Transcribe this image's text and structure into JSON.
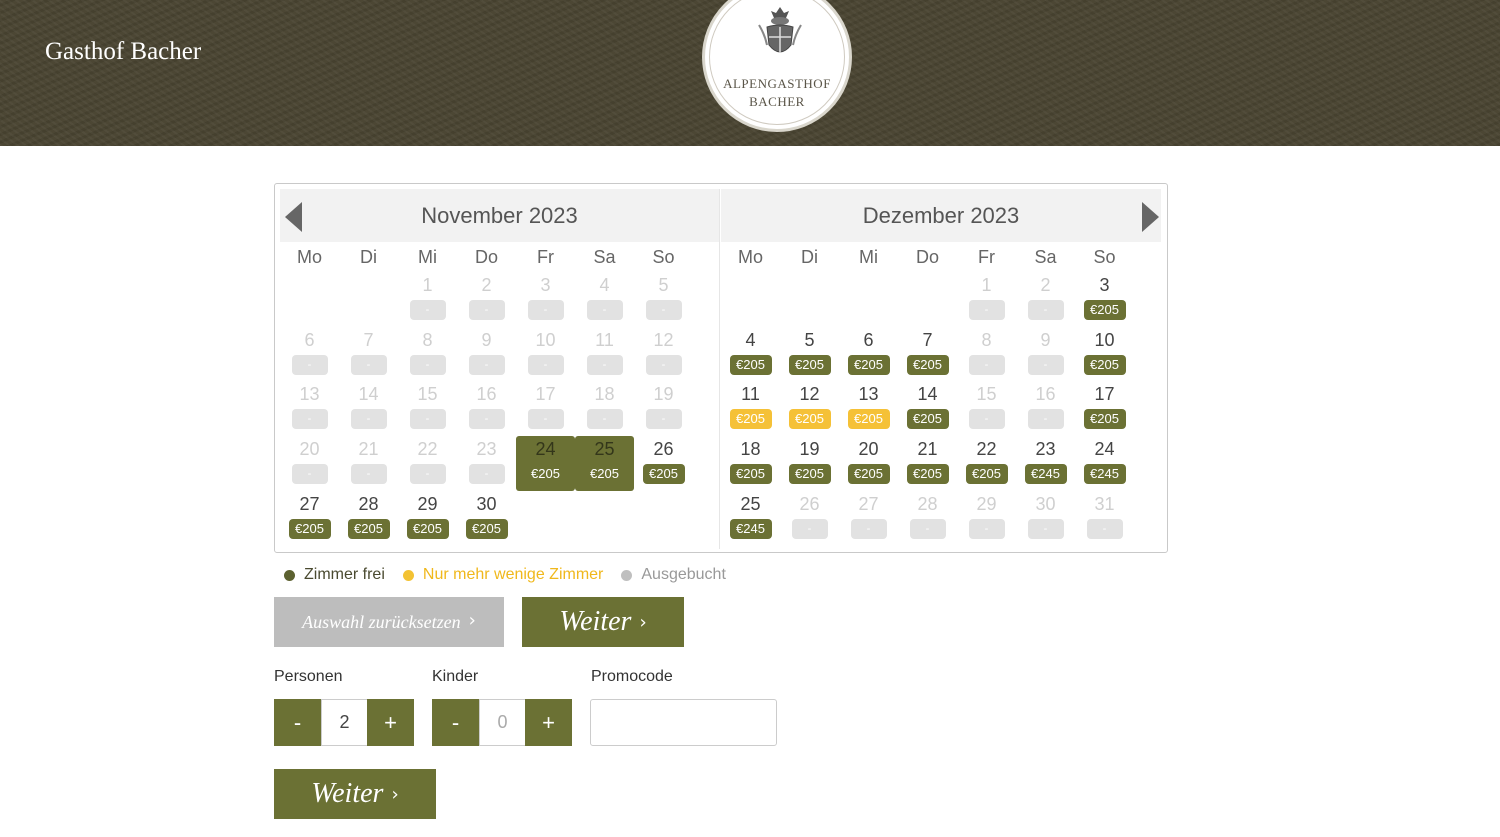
{
  "header": {
    "brand": "Gasthof Bacher",
    "logo_line1": "ALPENGASTHOF",
    "logo_line2": "BACHER"
  },
  "calendar": {
    "weekday_labels": [
      "Mo",
      "Di",
      "Mi",
      "Do",
      "Fr",
      "Sa",
      "So"
    ],
    "months": [
      {
        "title": "November 2023",
        "weeks": [
          [
            null,
            null,
            {
              "d": "1",
              "p": "-",
              "s": "na"
            },
            {
              "d": "2",
              "p": "-",
              "s": "na"
            },
            {
              "d": "3",
              "p": "-",
              "s": "na"
            },
            {
              "d": "4",
              "p": "-",
              "s": "na"
            },
            {
              "d": "5",
              "p": "-",
              "s": "na"
            }
          ],
          [
            {
              "d": "6",
              "p": "-",
              "s": "na"
            },
            {
              "d": "7",
              "p": "-",
              "s": "na"
            },
            {
              "d": "8",
              "p": "-",
              "s": "na"
            },
            {
              "d": "9",
              "p": "-",
              "s": "na"
            },
            {
              "d": "10",
              "p": "-",
              "s": "na"
            },
            {
              "d": "11",
              "p": "-",
              "s": "na"
            },
            {
              "d": "12",
              "p": "-",
              "s": "na"
            }
          ],
          [
            {
              "d": "13",
              "p": "-",
              "s": "na"
            },
            {
              "d": "14",
              "p": "-",
              "s": "na"
            },
            {
              "d": "15",
              "p": "-",
              "s": "na"
            },
            {
              "d": "16",
              "p": "-",
              "s": "na"
            },
            {
              "d": "17",
              "p": "-",
              "s": "na"
            },
            {
              "d": "18",
              "p": "-",
              "s": "na"
            },
            {
              "d": "19",
              "p": "-",
              "s": "na"
            }
          ],
          [
            {
              "d": "20",
              "p": "-",
              "s": "na"
            },
            {
              "d": "21",
              "p": "-",
              "s": "na"
            },
            {
              "d": "22",
              "p": "-",
              "s": "na"
            },
            {
              "d": "23",
              "p": "-",
              "s": "na"
            },
            {
              "d": "24",
              "p": "€205",
              "s": "sel"
            },
            {
              "d": "25",
              "p": "€205",
              "s": "sel"
            },
            {
              "d": "26",
              "p": "€205",
              "s": "free"
            }
          ],
          [
            {
              "d": "27",
              "p": "€205",
              "s": "free"
            },
            {
              "d": "28",
              "p": "€205",
              "s": "free"
            },
            {
              "d": "29",
              "p": "€205",
              "s": "free"
            },
            {
              "d": "30",
              "p": "€205",
              "s": "free"
            },
            null,
            null,
            null
          ]
        ]
      },
      {
        "title": "Dezember 2023",
        "weeks": [
          [
            null,
            null,
            null,
            null,
            {
              "d": "1",
              "p": "-",
              "s": "na"
            },
            {
              "d": "2",
              "p": "-",
              "s": "na"
            },
            {
              "d": "3",
              "p": "€205",
              "s": "free"
            }
          ],
          [
            {
              "d": "4",
              "p": "€205",
              "s": "free"
            },
            {
              "d": "5",
              "p": "€205",
              "s": "free"
            },
            {
              "d": "6",
              "p": "€205",
              "s": "free"
            },
            {
              "d": "7",
              "p": "€205",
              "s": "free"
            },
            {
              "d": "8",
              "p": "-",
              "s": "na"
            },
            {
              "d": "9",
              "p": "-",
              "s": "na"
            },
            {
              "d": "10",
              "p": "€205",
              "s": "free"
            }
          ],
          [
            {
              "d": "11",
              "p": "€205",
              "s": "few"
            },
            {
              "d": "12",
              "p": "€205",
              "s": "few"
            },
            {
              "d": "13",
              "p": "€205",
              "s": "few"
            },
            {
              "d": "14",
              "p": "€205",
              "s": "free"
            },
            {
              "d": "15",
              "p": "-",
              "s": "na"
            },
            {
              "d": "16",
              "p": "-",
              "s": "na"
            },
            {
              "d": "17",
              "p": "€205",
              "s": "free"
            }
          ],
          [
            {
              "d": "18",
              "p": "€205",
              "s": "free"
            },
            {
              "d": "19",
              "p": "€205",
              "s": "free"
            },
            {
              "d": "20",
              "p": "€205",
              "s": "free"
            },
            {
              "d": "21",
              "p": "€205",
              "s": "free"
            },
            {
              "d": "22",
              "p": "€205",
              "s": "free"
            },
            {
              "d": "23",
              "p": "€245",
              "s": "free"
            },
            {
              "d": "24",
              "p": "€245",
              "s": "free"
            }
          ],
          [
            {
              "d": "25",
              "p": "€245",
              "s": "free"
            },
            {
              "d": "26",
              "p": "-",
              "s": "na"
            },
            {
              "d": "27",
              "p": "-",
              "s": "na"
            },
            {
              "d": "28",
              "p": "-",
              "s": "na"
            },
            {
              "d": "29",
              "p": "-",
              "s": "na"
            },
            {
              "d": "30",
              "p": "-",
              "s": "na"
            },
            {
              "d": "31",
              "p": "-",
              "s": "na"
            }
          ]
        ]
      }
    ]
  },
  "legend": {
    "free": "Zimmer frei",
    "few": "Nur mehr wenige Zimmer",
    "booked": "Ausgebucht"
  },
  "actions": {
    "reset": "Auswahl zurücksetzen",
    "next": "Weiter"
  },
  "form": {
    "persons_label": "Personen",
    "persons_value": "2",
    "children_label": "Kinder",
    "children_value": "0",
    "promo_label": "Promocode",
    "promo_value": "",
    "minus": "-",
    "plus": "+"
  },
  "colors": {
    "accent": "#6b7134",
    "few": "#f5c137",
    "booked": "#e2e2e2"
  }
}
